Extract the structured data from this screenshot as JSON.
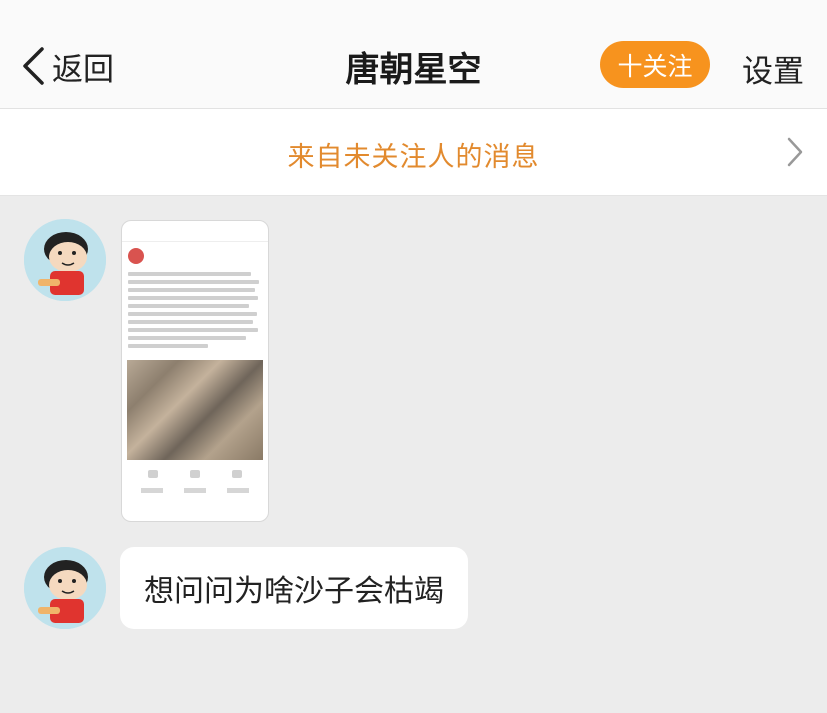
{
  "header": {
    "back_label": "返回",
    "title": "唐朝星空",
    "follow_label": "十关注",
    "settings_label": "设置"
  },
  "notice": {
    "text": "来自未关注人的消息"
  },
  "messages": [
    {
      "type": "image",
      "description_icon": "weibo-post-screenshot"
    },
    {
      "type": "text",
      "text": "想问问为啥沙子会枯竭"
    }
  ],
  "colors": {
    "accent_orange": "#f7931e",
    "notice_text": "#e28a2e",
    "background": "#ececec"
  }
}
